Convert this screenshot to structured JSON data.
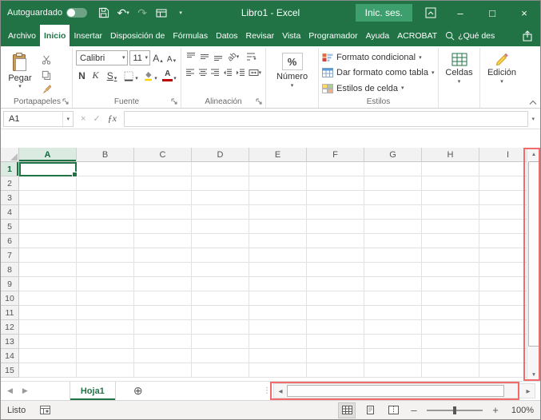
{
  "colors": {
    "excel_green": "#217346",
    "signin_background": "#3d9e6e",
    "annotation_red": "#f26b6b",
    "selection_border": "#217346"
  },
  "titlebar": {
    "autosave_label": "Autoguardado",
    "title": "Libro1 - Excel",
    "signin_label": "Inic. ses."
  },
  "glyphs": {
    "caret": "▾",
    "caret_up": "▴",
    "undo": "↶",
    "redo": "↷",
    "minimize": "–",
    "maximize": "□",
    "close": "×",
    "cancel": "×",
    "enter": "✓",
    "fx": "ƒx",
    "left": "◀",
    "right": "▶",
    "up": "▲",
    "down": "▼",
    "add_sheet": "⊕",
    "splitter": "⋮",
    "zoom_out": "–",
    "zoom_in": "+"
  },
  "ribbon": {
    "tabs": [
      {
        "label": "Archivo",
        "name": "archivo"
      },
      {
        "label": "Inicio",
        "name": "inicio",
        "active": true
      },
      {
        "label": "Insertar",
        "name": "insertar"
      },
      {
        "label": "Disposición de",
        "name": "disposicion-de-pagina"
      },
      {
        "label": "Fórmulas",
        "name": "formulas"
      },
      {
        "label": "Datos",
        "name": "datos"
      },
      {
        "label": "Revisar",
        "name": "revisar"
      },
      {
        "label": "Vista",
        "name": "vista"
      },
      {
        "label": "Programador",
        "name": "programador"
      },
      {
        "label": "Ayuda",
        "name": "ayuda"
      },
      {
        "label": "ACROBAT",
        "name": "acrobat"
      }
    ],
    "tellme_label": "¿Qué des",
    "groups": {
      "clipboard": {
        "label": "Portapapeles",
        "paste": "Pegar"
      },
      "font": {
        "label": "Fuente",
        "family": "Calibri",
        "size": "11",
        "bold": "N",
        "italic": "K",
        "underline": "S",
        "grow": "A",
        "shrink": "A"
      },
      "alignment": {
        "label": "Alineación",
        "wrap": "ab",
        "orientation": "ab"
      },
      "number": {
        "label": "Número",
        "percent": "%"
      },
      "styles": {
        "label": "Estilos",
        "items": [
          "Formato condicional",
          "Dar formato como tabla",
          "Estilos de celda"
        ]
      },
      "cells": {
        "label": "Celdas"
      },
      "editing": {
        "label": "Edición"
      }
    }
  },
  "formula_bar": {
    "name_box": "A1",
    "formula": ""
  },
  "grid": {
    "columns": [
      "A",
      "B",
      "C",
      "D",
      "E",
      "F",
      "G",
      "H",
      "I"
    ],
    "rows": [
      "1",
      "2",
      "3",
      "4",
      "5",
      "6",
      "7",
      "8",
      "9",
      "10",
      "11",
      "12",
      "13",
      "14",
      "15"
    ],
    "selected": {
      "col": "A",
      "row": "1",
      "cell": "A1"
    }
  },
  "sheet_bar": {
    "tab": "Hoja1"
  },
  "status_bar": {
    "ready": "Listo",
    "zoom": "100%"
  }
}
